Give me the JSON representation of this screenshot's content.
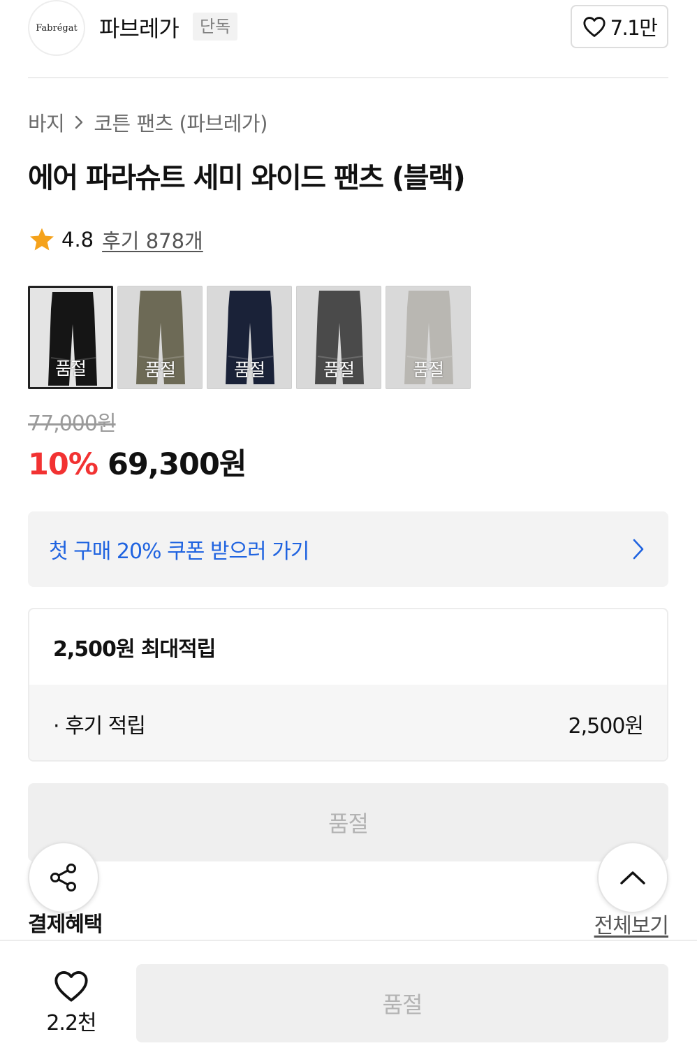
{
  "brand": {
    "logo_text": "Fabrégat",
    "name": "파브레가",
    "badge": "단독",
    "like_count": "7.1만"
  },
  "breadcrumb": {
    "category": "바지",
    "subcategory": "코튼 팬츠 (파브레가)"
  },
  "product": {
    "title": "에어 파라슈트 세미 와이드 팬츠 (블랙)",
    "rating": "4.8",
    "reviews": "후기 878개"
  },
  "swatches": [
    {
      "status": "품절",
      "color": "#151515"
    },
    {
      "status": "품절",
      "color": "#6d6a56"
    },
    {
      "status": "품절",
      "color": "#1a2238"
    },
    {
      "status": "품절",
      "color": "#4a4a4a"
    },
    {
      "status": "품절",
      "color": "#b9b7b2"
    }
  ],
  "price": {
    "original": "77,000원",
    "discount": "10%",
    "final": "69,300원"
  },
  "coupon": {
    "label": "첫 구매 20% 쿠폰 받으러 가기"
  },
  "points": {
    "header": "2,500원 최대적립",
    "row_label": "· 후기 적립",
    "row_value": "2,500원"
  },
  "buttons": {
    "soldout": "품절",
    "payment_benefit": "결제혜택",
    "view_all": "전체보기",
    "buy": "품절"
  },
  "bottom": {
    "like_count": "2.2천"
  },
  "colors": {
    "accent_blue": "#1f63e0",
    "discount_red": "#f23232"
  },
  "icons": [
    "heart-icon",
    "chevron-right-icon",
    "star-icon",
    "share-icon",
    "chevron-up-icon"
  ]
}
